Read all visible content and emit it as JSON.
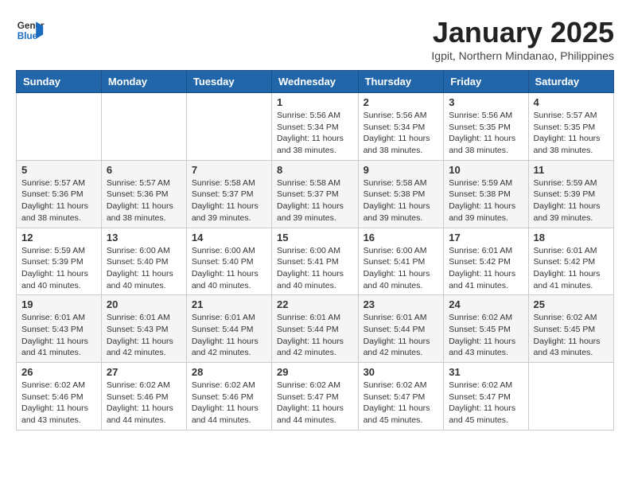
{
  "header": {
    "logo_line1": "General",
    "logo_line2": "Blue",
    "month_title": "January 2025",
    "subtitle": "Igpit, Northern Mindanao, Philippines"
  },
  "columns": [
    "Sunday",
    "Monday",
    "Tuesday",
    "Wednesday",
    "Thursday",
    "Friday",
    "Saturday"
  ],
  "weeks": [
    [
      {
        "day": "",
        "sunrise": "",
        "sunset": "",
        "daylight": ""
      },
      {
        "day": "",
        "sunrise": "",
        "sunset": "",
        "daylight": ""
      },
      {
        "day": "",
        "sunrise": "",
        "sunset": "",
        "daylight": ""
      },
      {
        "day": "1",
        "sunrise": "Sunrise: 5:56 AM",
        "sunset": "Sunset: 5:34 PM",
        "daylight": "Daylight: 11 hours and 38 minutes."
      },
      {
        "day": "2",
        "sunrise": "Sunrise: 5:56 AM",
        "sunset": "Sunset: 5:34 PM",
        "daylight": "Daylight: 11 hours and 38 minutes."
      },
      {
        "day": "3",
        "sunrise": "Sunrise: 5:56 AM",
        "sunset": "Sunset: 5:35 PM",
        "daylight": "Daylight: 11 hours and 38 minutes."
      },
      {
        "day": "4",
        "sunrise": "Sunrise: 5:57 AM",
        "sunset": "Sunset: 5:35 PM",
        "daylight": "Daylight: 11 hours and 38 minutes."
      }
    ],
    [
      {
        "day": "5",
        "sunrise": "Sunrise: 5:57 AM",
        "sunset": "Sunset: 5:36 PM",
        "daylight": "Daylight: 11 hours and 38 minutes."
      },
      {
        "day": "6",
        "sunrise": "Sunrise: 5:57 AM",
        "sunset": "Sunset: 5:36 PM",
        "daylight": "Daylight: 11 hours and 38 minutes."
      },
      {
        "day": "7",
        "sunrise": "Sunrise: 5:58 AM",
        "sunset": "Sunset: 5:37 PM",
        "daylight": "Daylight: 11 hours and 39 minutes."
      },
      {
        "day": "8",
        "sunrise": "Sunrise: 5:58 AM",
        "sunset": "Sunset: 5:37 PM",
        "daylight": "Daylight: 11 hours and 39 minutes."
      },
      {
        "day": "9",
        "sunrise": "Sunrise: 5:58 AM",
        "sunset": "Sunset: 5:38 PM",
        "daylight": "Daylight: 11 hours and 39 minutes."
      },
      {
        "day": "10",
        "sunrise": "Sunrise: 5:59 AM",
        "sunset": "Sunset: 5:38 PM",
        "daylight": "Daylight: 11 hours and 39 minutes."
      },
      {
        "day": "11",
        "sunrise": "Sunrise: 5:59 AM",
        "sunset": "Sunset: 5:39 PM",
        "daylight": "Daylight: 11 hours and 39 minutes."
      }
    ],
    [
      {
        "day": "12",
        "sunrise": "Sunrise: 5:59 AM",
        "sunset": "Sunset: 5:39 PM",
        "daylight": "Daylight: 11 hours and 40 minutes."
      },
      {
        "day": "13",
        "sunrise": "Sunrise: 6:00 AM",
        "sunset": "Sunset: 5:40 PM",
        "daylight": "Daylight: 11 hours and 40 minutes."
      },
      {
        "day": "14",
        "sunrise": "Sunrise: 6:00 AM",
        "sunset": "Sunset: 5:40 PM",
        "daylight": "Daylight: 11 hours and 40 minutes."
      },
      {
        "day": "15",
        "sunrise": "Sunrise: 6:00 AM",
        "sunset": "Sunset: 5:41 PM",
        "daylight": "Daylight: 11 hours and 40 minutes."
      },
      {
        "day": "16",
        "sunrise": "Sunrise: 6:00 AM",
        "sunset": "Sunset: 5:41 PM",
        "daylight": "Daylight: 11 hours and 40 minutes."
      },
      {
        "day": "17",
        "sunrise": "Sunrise: 6:01 AM",
        "sunset": "Sunset: 5:42 PM",
        "daylight": "Daylight: 11 hours and 41 minutes."
      },
      {
        "day": "18",
        "sunrise": "Sunrise: 6:01 AM",
        "sunset": "Sunset: 5:42 PM",
        "daylight": "Daylight: 11 hours and 41 minutes."
      }
    ],
    [
      {
        "day": "19",
        "sunrise": "Sunrise: 6:01 AM",
        "sunset": "Sunset: 5:43 PM",
        "daylight": "Daylight: 11 hours and 41 minutes."
      },
      {
        "day": "20",
        "sunrise": "Sunrise: 6:01 AM",
        "sunset": "Sunset: 5:43 PM",
        "daylight": "Daylight: 11 hours and 42 minutes."
      },
      {
        "day": "21",
        "sunrise": "Sunrise: 6:01 AM",
        "sunset": "Sunset: 5:44 PM",
        "daylight": "Daylight: 11 hours and 42 minutes."
      },
      {
        "day": "22",
        "sunrise": "Sunrise: 6:01 AM",
        "sunset": "Sunset: 5:44 PM",
        "daylight": "Daylight: 11 hours and 42 minutes."
      },
      {
        "day": "23",
        "sunrise": "Sunrise: 6:01 AM",
        "sunset": "Sunset: 5:44 PM",
        "daylight": "Daylight: 11 hours and 42 minutes."
      },
      {
        "day": "24",
        "sunrise": "Sunrise: 6:02 AM",
        "sunset": "Sunset: 5:45 PM",
        "daylight": "Daylight: 11 hours and 43 minutes."
      },
      {
        "day": "25",
        "sunrise": "Sunrise: 6:02 AM",
        "sunset": "Sunset: 5:45 PM",
        "daylight": "Daylight: 11 hours and 43 minutes."
      }
    ],
    [
      {
        "day": "26",
        "sunrise": "Sunrise: 6:02 AM",
        "sunset": "Sunset: 5:46 PM",
        "daylight": "Daylight: 11 hours and 43 minutes."
      },
      {
        "day": "27",
        "sunrise": "Sunrise: 6:02 AM",
        "sunset": "Sunset: 5:46 PM",
        "daylight": "Daylight: 11 hours and 44 minutes."
      },
      {
        "day": "28",
        "sunrise": "Sunrise: 6:02 AM",
        "sunset": "Sunset: 5:46 PM",
        "daylight": "Daylight: 11 hours and 44 minutes."
      },
      {
        "day": "29",
        "sunrise": "Sunrise: 6:02 AM",
        "sunset": "Sunset: 5:47 PM",
        "daylight": "Daylight: 11 hours and 44 minutes."
      },
      {
        "day": "30",
        "sunrise": "Sunrise: 6:02 AM",
        "sunset": "Sunset: 5:47 PM",
        "daylight": "Daylight: 11 hours and 45 minutes."
      },
      {
        "day": "31",
        "sunrise": "Sunrise: 6:02 AM",
        "sunset": "Sunset: 5:47 PM",
        "daylight": "Daylight: 11 hours and 45 minutes."
      },
      {
        "day": "",
        "sunrise": "",
        "sunset": "",
        "daylight": ""
      }
    ]
  ]
}
